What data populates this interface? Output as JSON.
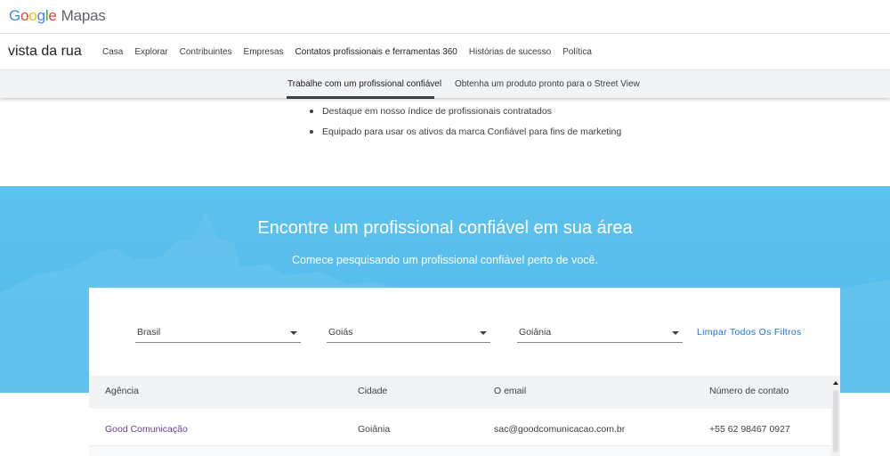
{
  "header": {
    "logo_letters": [
      "G",
      "o",
      "o",
      "g",
      "l",
      "e"
    ],
    "product": "Mapas"
  },
  "nav": {
    "brand": "vista da rua",
    "links": [
      "Casa",
      "Explorar",
      "Contribuintes",
      "Empresas",
      "Contatos profissionais e ferramentas 360",
      "Histórias de sucesso",
      "Política"
    ]
  },
  "subnav": {
    "tabs": [
      "Trabalhe com um profissional confiável",
      "Obtenha um produto pronto para o Street View"
    ],
    "active_index": 0
  },
  "bullets": [
    "Destaque em nosso índice de profissionais contratados",
    "Equipado para usar os ativos da marca Confiável para fins de marketing"
  ],
  "hero": {
    "title": "Encontre um profissional confiável em sua área",
    "subtitle": "Comece pesquisando um profissional confiável perto de você."
  },
  "filters": {
    "country": "Brasil",
    "state": "Goiás",
    "city": "Goiânia",
    "clear_label": "Limpar Todos Os Filtros"
  },
  "table": {
    "headers": [
      "Agência",
      "Cidade",
      "O email",
      "Número de contato"
    ],
    "rows": [
      [
        "Good Comunicação",
        "Goiânia",
        "sac@goodcomunicacao.com.br",
        "+55 62 98467 0927"
      ]
    ]
  },
  "colors": {
    "hero_bg": "#56bcea",
    "link_blue": "#1a73e8",
    "visited_purple": "#6a3b92"
  }
}
